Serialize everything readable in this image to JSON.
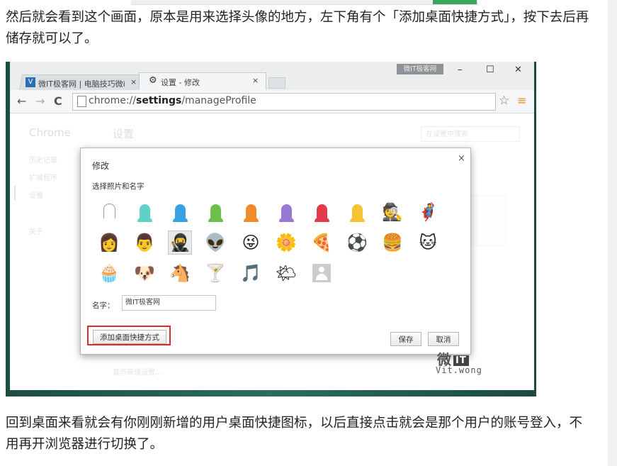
{
  "article": {
    "paragraph_1": "然后就会看到这个画面，原本是用来选择头像的地方，左下角有个「添加桌面快捷方式」，按下去后再储存就可以了。",
    "paragraph_2": "回到桌面来看就会有你刚刚新增的用户桌面快捷图标，以后直接点击就会是那个用户的账号登入，不用再开浏览器进行切换了。"
  },
  "browser": {
    "tab1_label": "微IT极客网 | 电脑技巧微i",
    "tab1_icon_letter": "V",
    "tab1_close": "×",
    "tab2_label": "设置 - 修改",
    "tab2_close": "×",
    "watermark_badge": "微IT极客网",
    "window_minimize": "–",
    "window_maximize": "☐",
    "window_close": "✕",
    "back": "←",
    "forward": "→",
    "reload": "C",
    "url_prefix": "chrome://",
    "url_bold": "settings",
    "url_suffix": "/manageProfile",
    "star": "☆",
    "menu": "≡"
  },
  "settings_page": {
    "sidebar_title": "Chrome",
    "page_title": "设置",
    "search_placeholder": "在设置中搜索",
    "sidebar_items": [
      "历史记录",
      "扩展程序",
      "设置",
      "关于"
    ],
    "footer_link": "显示高级设置..."
  },
  "dialog": {
    "title": "修改",
    "close": "×",
    "subtitle": "选择照片和名字",
    "avatars": [
      {
        "name": "avatar-generic-white",
        "kind": "head",
        "color": "#ffffff"
      },
      {
        "name": "avatar-generic-aqua",
        "kind": "head",
        "color": "#5fd1c6"
      },
      {
        "name": "avatar-generic-blue",
        "kind": "head",
        "color": "#3aa0e4"
      },
      {
        "name": "avatar-generic-green",
        "kind": "head",
        "color": "#6cc04a"
      },
      {
        "name": "avatar-generic-orange",
        "kind": "head",
        "color": "#f08a2a"
      },
      {
        "name": "avatar-generic-purple",
        "kind": "head",
        "color": "#9a78d6"
      },
      {
        "name": "avatar-generic-red",
        "kind": "head",
        "color": "#e33b4a"
      },
      {
        "name": "avatar-generic-yellow",
        "kind": "head",
        "color": "#f5c434"
      },
      {
        "name": "avatar-secret-agent",
        "kind": "emoji",
        "glyph": "🕵"
      },
      {
        "name": "avatar-superhero",
        "kind": "emoji",
        "glyph": "🦸"
      },
      {
        "name": "avatar-volleyball-player",
        "kind": "emoji",
        "glyph": "👩"
      },
      {
        "name": "avatar-businessman",
        "kind": "emoji",
        "glyph": "👨"
      },
      {
        "name": "avatar-ninja",
        "kind": "emoji",
        "glyph": "🥷",
        "selected": true
      },
      {
        "name": "avatar-alien",
        "kind": "emoji",
        "glyph": "👽"
      },
      {
        "name": "avatar-awesome-face",
        "kind": "emoji",
        "glyph": "😜"
      },
      {
        "name": "avatar-flower",
        "kind": "emoji",
        "glyph": "🌼"
      },
      {
        "name": "avatar-pizza",
        "kind": "emoji",
        "glyph": "🍕"
      },
      {
        "name": "avatar-soccer",
        "kind": "emoji",
        "glyph": "⚽"
      },
      {
        "name": "avatar-burger",
        "kind": "emoji",
        "glyph": "🍔"
      },
      {
        "name": "avatar-cat",
        "kind": "emoji",
        "glyph": "🐱"
      },
      {
        "name": "avatar-cupcake",
        "kind": "emoji",
        "glyph": "🧁"
      },
      {
        "name": "avatar-dog",
        "kind": "emoji",
        "glyph": "🐶"
      },
      {
        "name": "avatar-horse",
        "kind": "emoji",
        "glyph": "🐴"
      },
      {
        "name": "avatar-martini",
        "kind": "emoji",
        "glyph": "🍸"
      },
      {
        "name": "avatar-music-note",
        "kind": "emoji",
        "glyph": "🎵"
      },
      {
        "name": "avatar-sun-cloud",
        "kind": "emoji",
        "glyph": "🌤"
      },
      {
        "name": "avatar-placeholder",
        "kind": "generic"
      }
    ],
    "name_label": "名字：",
    "name_value": "微IT极客网",
    "shortcut_button": "添加桌面快捷方式",
    "save_button": "保存",
    "cancel_button": "取消"
  },
  "watermark": {
    "logo_char": "微",
    "logo_it": "IT",
    "subtitle": "Vit.wong"
  }
}
